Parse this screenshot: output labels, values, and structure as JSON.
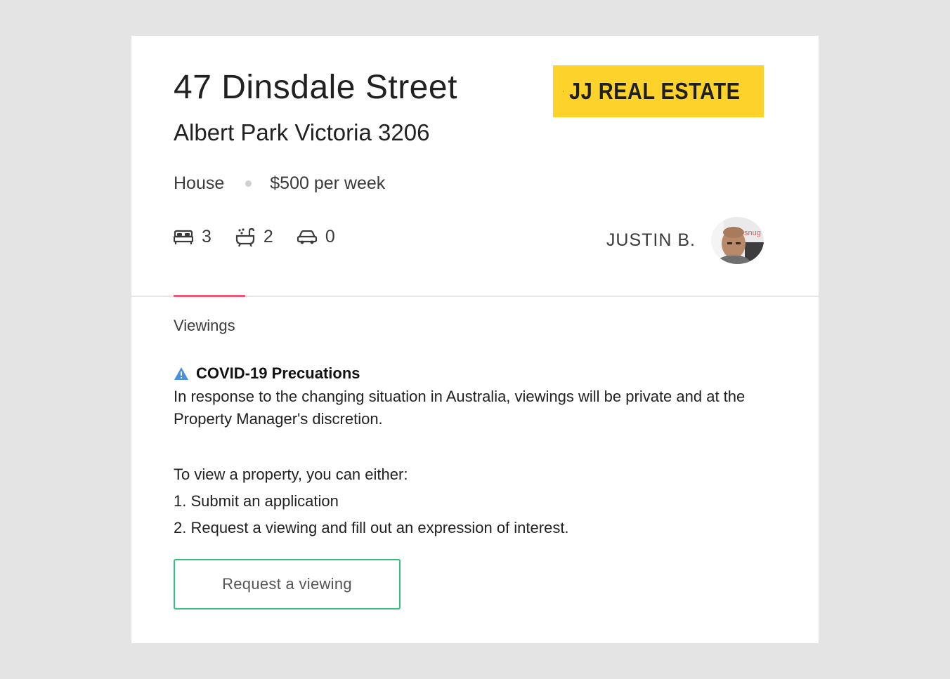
{
  "property": {
    "street": "47 Dinsdale Street",
    "suburb": "Albert Park Victoria 3206",
    "type": "House",
    "price": "$500 per week",
    "bedrooms": "3",
    "bathrooms": "2",
    "parking": "0"
  },
  "agency": {
    "logo_text": "JJ REAL ESTATE",
    "brand_color": "#fdd22b"
  },
  "agent": {
    "name": "JUSTIN B.",
    "avatar_badge": "snug"
  },
  "tabs": [
    {
      "label": "Viewings",
      "active": true
    }
  ],
  "covid": {
    "title": "COVID-19 Precuations",
    "body": "In response to the changing situation in Australia, viewings will be private and at the Property Manager's discretion."
  },
  "instructions": {
    "intro": "To view a property, you can either:",
    "options": [
      "1. Submit an application",
      "2. Request a viewing and fill out an expression of interest."
    ]
  },
  "actions": {
    "request_viewing_label": "Request a viewing"
  },
  "colors": {
    "accent_tab": "#ec5a77",
    "button_border": "#34c07b",
    "warning_icon": "#4a90e2"
  }
}
